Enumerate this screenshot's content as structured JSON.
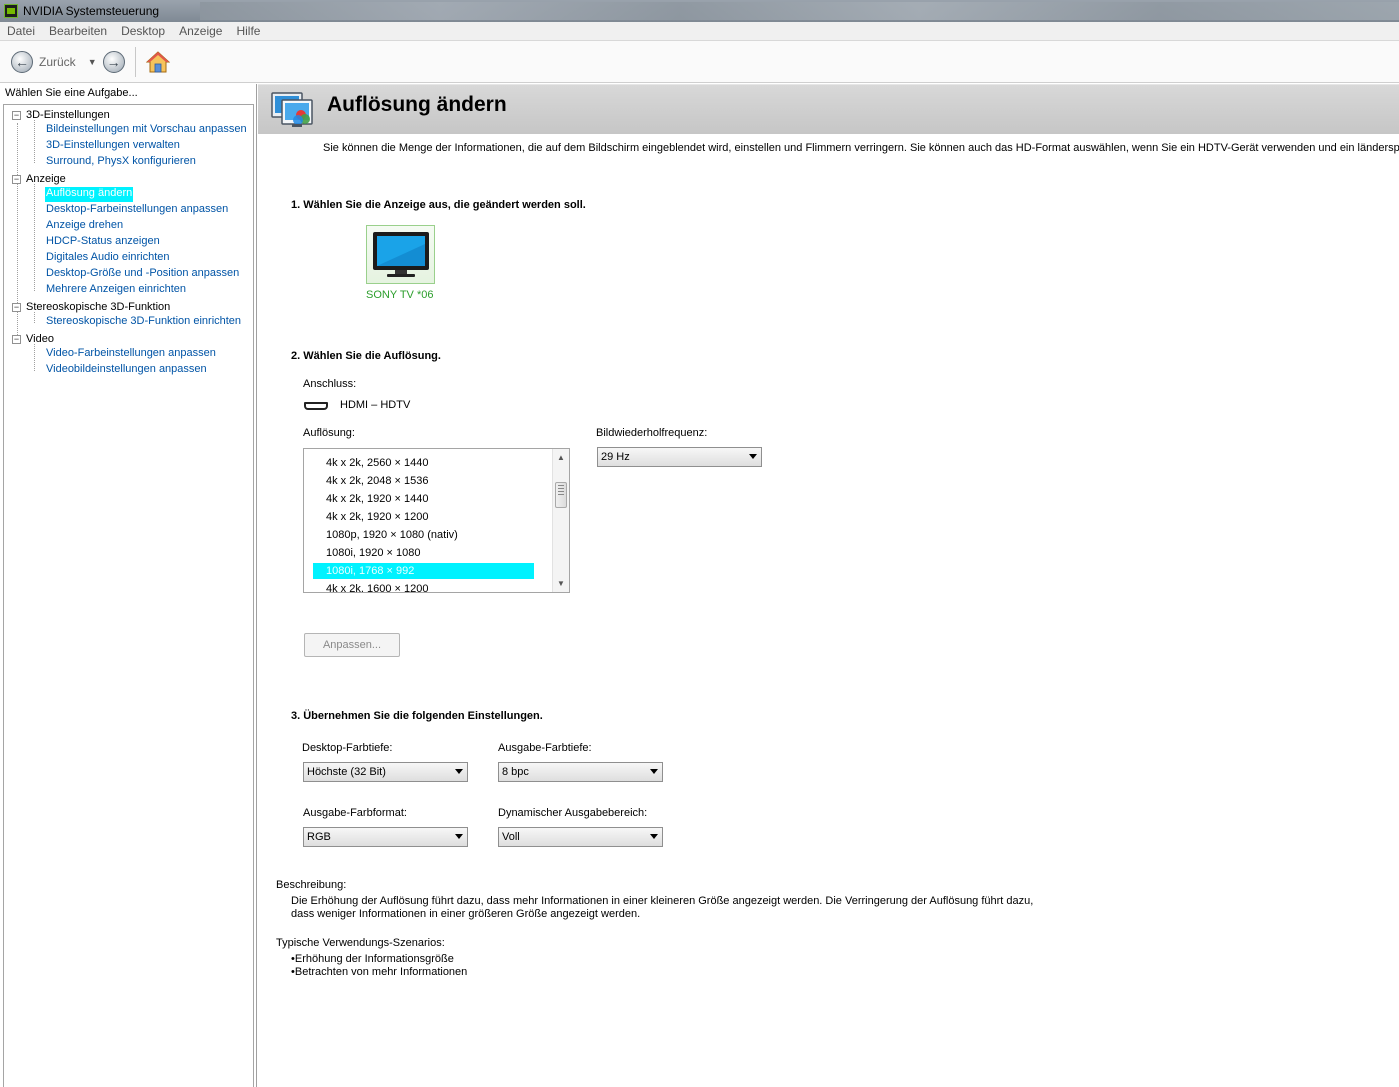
{
  "window": {
    "title": "NVIDIA Systemsteuerung"
  },
  "menu": [
    "Datei",
    "Bearbeiten",
    "Desktop",
    "Anzeige",
    "Hilfe"
  ],
  "toolbar": {
    "back_label": "Zurück"
  },
  "left_panel": {
    "header": "Wählen Sie eine Aufgabe...",
    "categories": [
      {
        "label": "3D-Einstellungen",
        "toggle": "−",
        "items": [
          "Bildeinstellungen mit Vorschau anpassen",
          "3D-Einstellungen verwalten",
          "Surround, PhysX konfigurieren"
        ]
      },
      {
        "label": "Anzeige",
        "toggle": "−",
        "items": [
          "Auflösung ändern",
          "Desktop-Farbeinstellungen anpassen",
          "Anzeige drehen",
          "HDCP-Status anzeigen",
          "Digitales Audio einrichten",
          "Desktop-Größe und -Position anpassen",
          "Mehrere Anzeigen einrichten"
        ]
      },
      {
        "label": "Stereoskopische 3D-Funktion",
        "toggle": "−",
        "items": [
          "Stereoskopische 3D-Funktion einrichten"
        ]
      },
      {
        "label": "Video",
        "toggle": "−",
        "items": [
          "Video-Farbeinstellungen anpassen",
          "Videobildeinstellungen anpassen"
        ]
      }
    ],
    "selected_item": "Auflösung ändern"
  },
  "page": {
    "title": "Auflösung ändern",
    "intro": "Sie können die Menge der Informationen, die auf dem Bildschirm eingeblendet wird, einstellen und Flimmern verringern. Sie können auch das HD-Format auswählen, wenn Sie ein HDTV-Gerät verwenden und ein länderspezifische",
    "section1": {
      "title": "1. Wählen Sie die Anzeige aus, die geändert werden soll.",
      "display_name": "SONY TV  *06"
    },
    "section2": {
      "title": "2. Wählen Sie die Auflösung.",
      "connection_label": "Anschluss:",
      "connection_value": "HDMI – HDTV",
      "resolution_label": "Auflösung:",
      "resolutions": [
        "4k x 2k, 2560 × 1440",
        "4k x 2k, 2048 × 1536",
        "4k x 2k, 1920 × 1440",
        "4k x 2k, 1920 × 1200",
        "1080p, 1920 × 1080 (nativ)",
        "1080i, 1920 × 1080",
        "1080i, 1768 × 992",
        "4k x 2k, 1600 × 1200"
      ],
      "selected_resolution": "1080i, 1768 × 992",
      "refresh_label": "Bildwiederholfrequenz:",
      "refresh_value": "29 Hz",
      "customize_label": "Anpassen..."
    },
    "section3": {
      "title": "3. Übernehmen Sie die folgenden Einstellungen.",
      "desktop_depth_label": "Desktop-Farbtiefe:",
      "desktop_depth_value": "Höchste (32 Bit)",
      "output_depth_label": "Ausgabe-Farbtiefe:",
      "output_depth_value": "8 bpc",
      "output_format_label": "Ausgabe-Farbformat:",
      "output_format_value": "RGB",
      "dynamic_range_label": "Dynamischer Ausgabebereich:",
      "dynamic_range_value": "Voll"
    },
    "description": {
      "label": "Beschreibung:",
      "line1": "Die Erhöhung der Auflösung führt dazu, dass mehr Informationen in einer kleineren Größe angezeigt werden. Die Verringerung der Auflösung führt dazu,",
      "line2": "dass weniger Informationen in einer größeren Größe angezeigt werden."
    },
    "scenarios": {
      "label": "Typische Verwendungs-Szenarios:",
      "items": [
        "Erhöhung der Informationsgröße",
        "Betrachten von mehr Informationen"
      ]
    }
  },
  "colors": {
    "selection": "#00f2ff",
    "link": "#0054a6",
    "display_name": "#2c9e2c",
    "nvidia_green": "#76b900"
  },
  "icons": [
    "nvidia-app-icon",
    "back-arrow-icon",
    "forward-arrow-icon",
    "home-icon",
    "display-settings-icon",
    "tv-icon",
    "hdmi-icon"
  ]
}
